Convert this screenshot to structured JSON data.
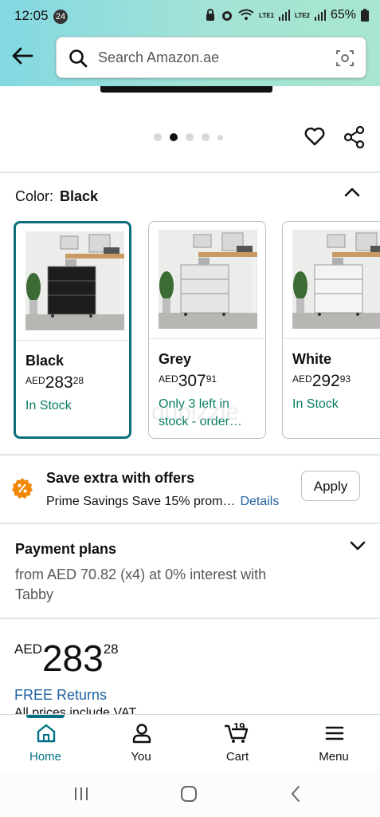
{
  "status_bar": {
    "time": "12:05",
    "badge": "24",
    "battery": "65%",
    "net1": "LTE1",
    "net2": "LTE2"
  },
  "search": {
    "placeholder": "Search Amazon.ae"
  },
  "gallery": {
    "dot_count": 5,
    "active_dot": 1
  },
  "color": {
    "label": "Color:",
    "value": "Black"
  },
  "swatches": [
    {
      "name": "Black",
      "currency": "AED",
      "whole": "283",
      "fraction": "28",
      "stock": "In Stock",
      "cabinet_color": "#1d1d1d"
    },
    {
      "name": "Grey",
      "currency": "AED",
      "whole": "307",
      "fraction": "91",
      "stock": "Only 3 left in stock - order…",
      "cabinet_color": "#e6e6e6"
    },
    {
      "name": "White",
      "currency": "AED",
      "whole": "292",
      "fraction": "93",
      "stock": "In Stock",
      "cabinet_color": "#f4f4f2"
    }
  ],
  "offers": {
    "title": "Save extra with offers",
    "subtitle": "Prime Savings Save 15% prom…",
    "link": "Details",
    "apply_label": "Apply"
  },
  "payment": {
    "title": "Payment plans",
    "text": "from AED 70.82 (x4) at 0% interest with Tabby"
  },
  "price": {
    "currency": "AED",
    "whole": "283",
    "fraction": "28"
  },
  "returns": {
    "label": "FREE Returns",
    "vat": "All prices include VAT."
  },
  "nav": [
    {
      "label": "Home",
      "icon": "home-icon"
    },
    {
      "label": "You",
      "icon": "person-icon"
    },
    {
      "label": "Cart",
      "icon": "cart-icon",
      "count": "19"
    },
    {
      "label": "Menu",
      "icon": "menu-icon"
    }
  ],
  "watermark": "dubizzle",
  "colors": {
    "accent": "#007185",
    "selected_border": "#0d6e7b",
    "in_stock": "#067d62",
    "link": "#2162a1"
  }
}
